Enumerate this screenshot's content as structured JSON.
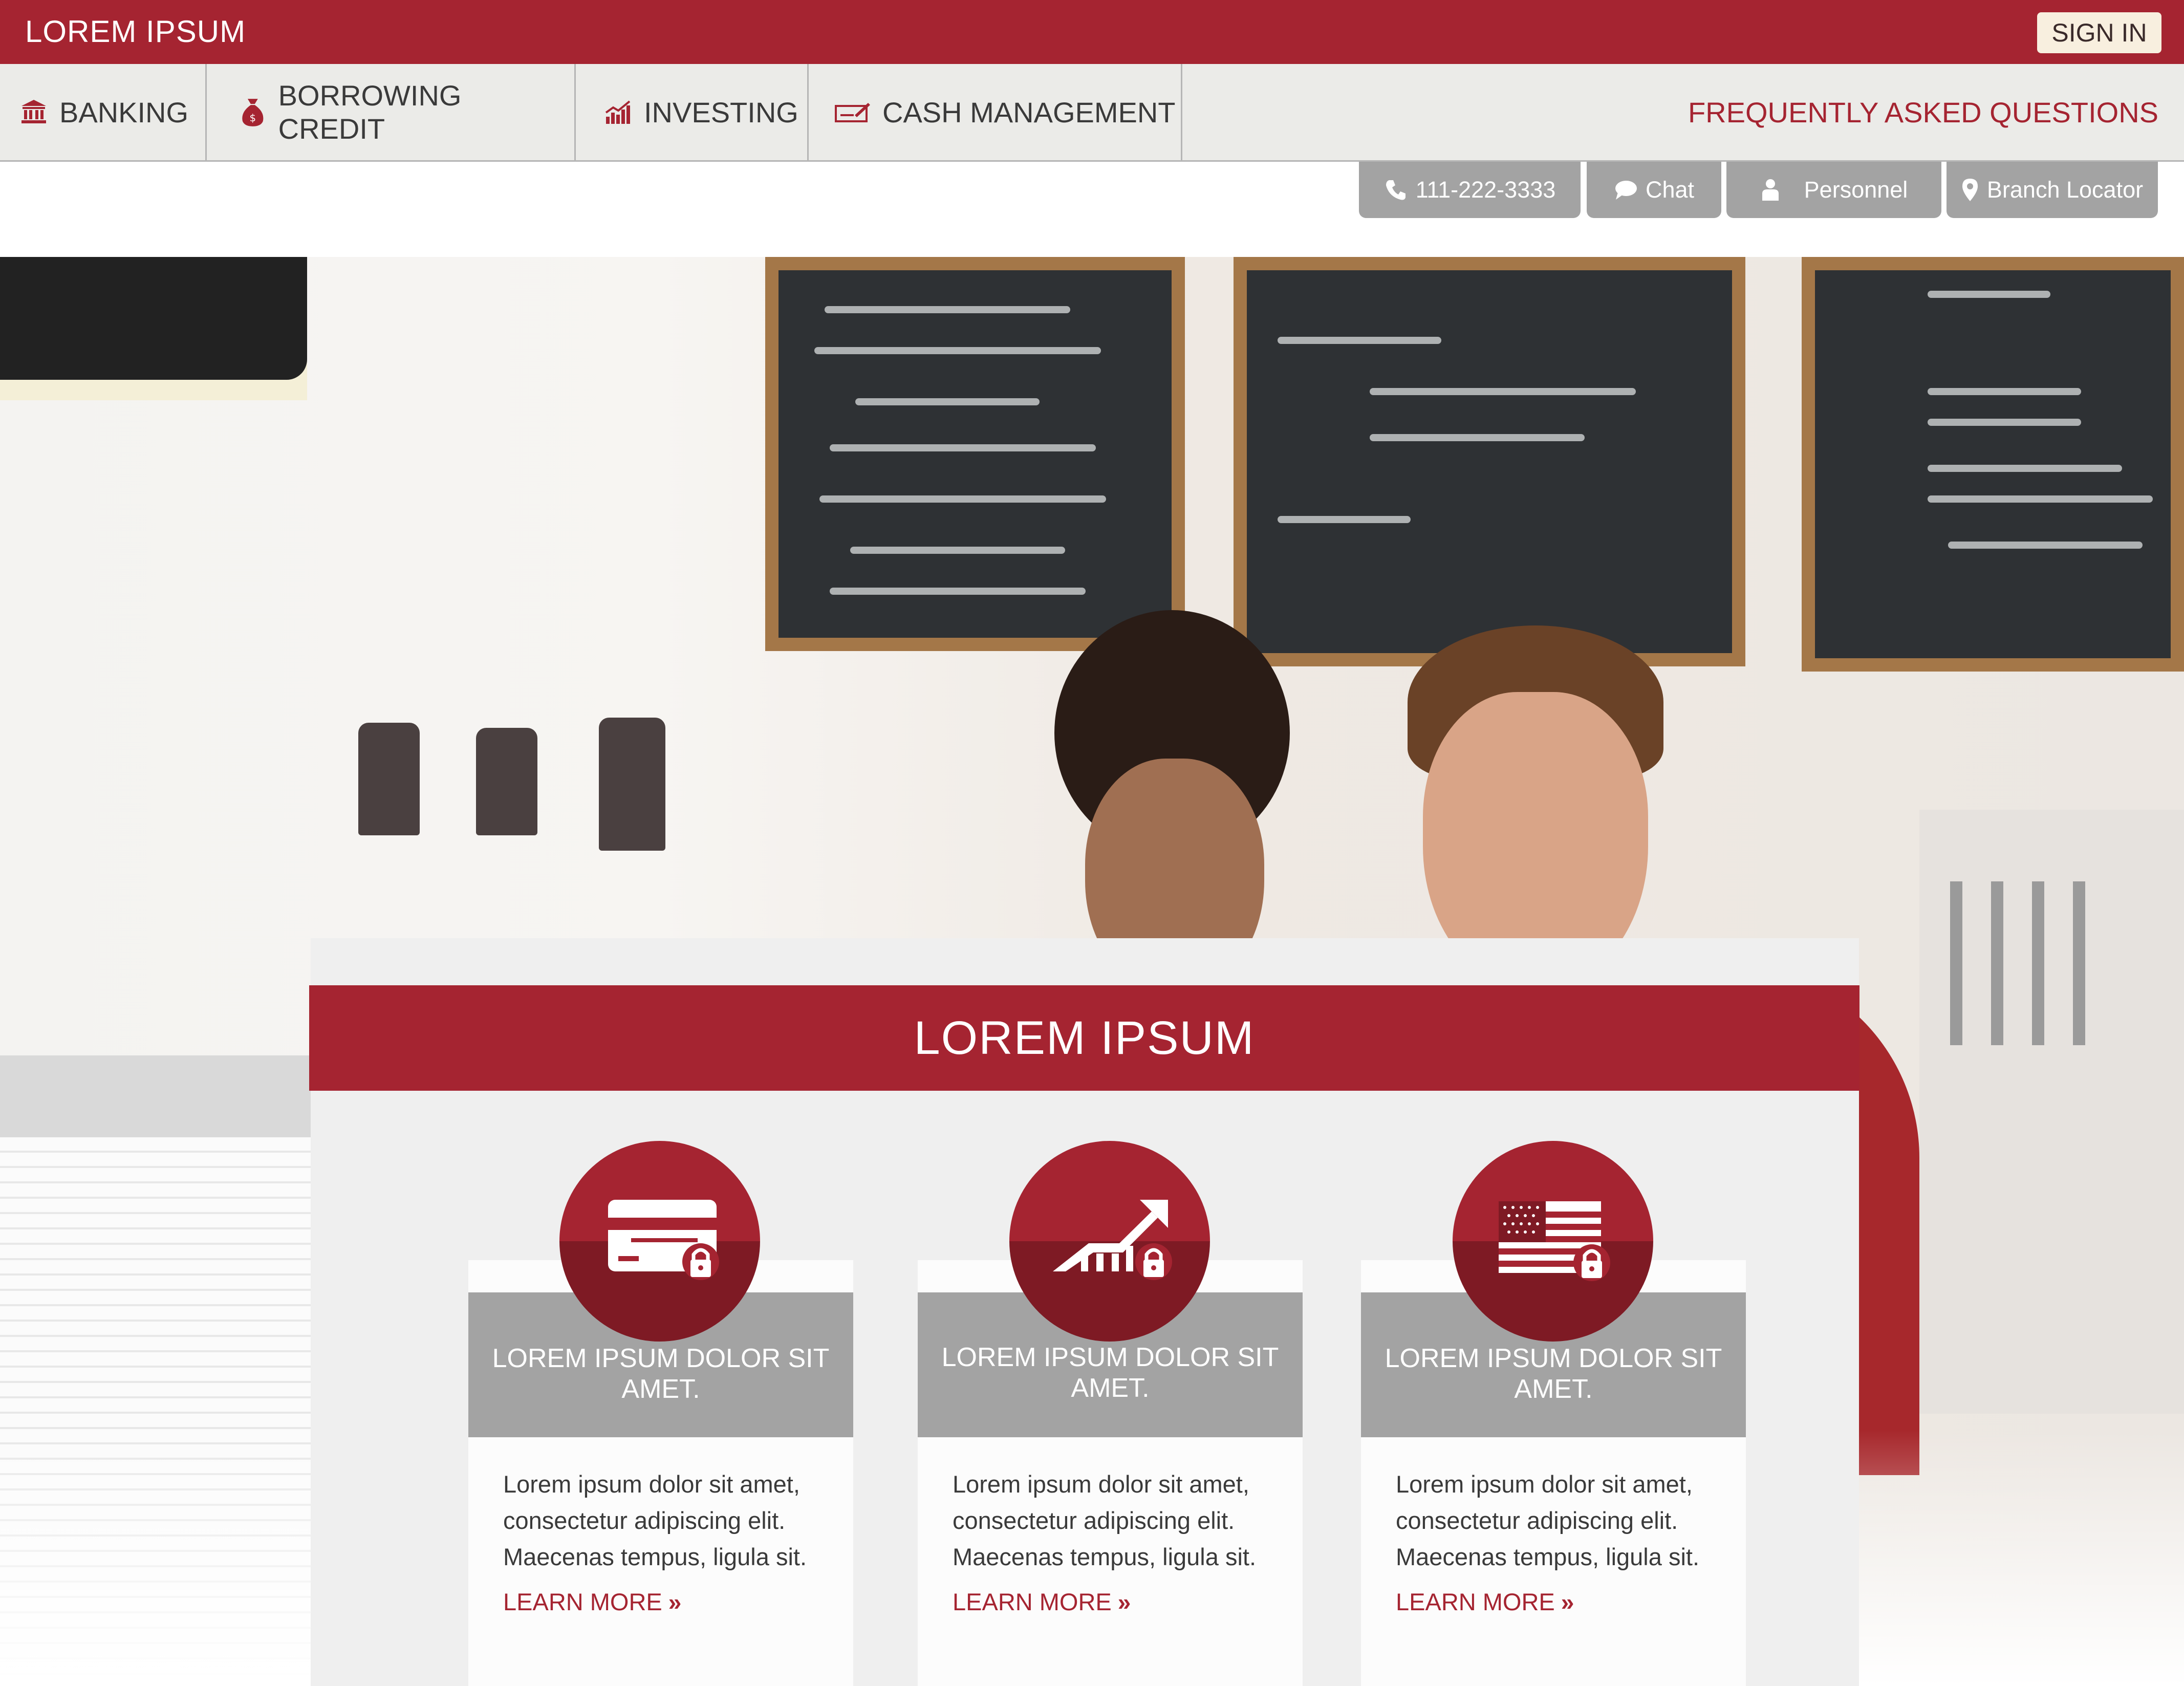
{
  "header": {
    "brand": "LOREM IPSUM",
    "sign_in": "SIGN IN"
  },
  "nav": {
    "items": [
      {
        "label": "BANKING",
        "icon": "bank-icon"
      },
      {
        "label": "BORROWING CREDIT",
        "icon": "money-bag-icon"
      },
      {
        "label": "INVESTING",
        "icon": "growth-chart-icon"
      },
      {
        "label": "CASH MANAGEMENT",
        "icon": "check-pen-icon"
      }
    ],
    "faq": "FREQUENTLY ASKED QUESTIONS"
  },
  "utility": {
    "phone": "111-222-3333",
    "chat": "Chat",
    "personnel": "Personnel",
    "branch": "Branch Locator"
  },
  "main": {
    "banner_title": "LOREM IPSUM",
    "cards": [
      {
        "icon": "credit-card-lock-icon",
        "title_line1": "LOREM IPSUM DOLOR SIT",
        "title_line2": "AMET.",
        "body_line1": "Lorem ipsum dolor sit amet,",
        "body_line2": "consectetur adipiscing elit.",
        "body_line3": "Maecenas tempus, ligula sit.",
        "link": "LEARN MORE"
      },
      {
        "icon": "growth-arrow-lock-icon",
        "title_line1": "LOREM IPSUM DOLOR SIT",
        "title_line2": "AMET.",
        "body_line1": "Lorem ipsum dolor sit amet,",
        "body_line2": "consectetur adipiscing elit.",
        "body_line3": "Maecenas tempus, ligula sit.",
        "link": "LEARN MORE"
      },
      {
        "icon": "us-flag-lock-icon",
        "title_line1": "LOREM IPSUM DOLOR SIT",
        "title_line2": "AMET.",
        "body_line1": "Lorem ipsum dolor sit amet,",
        "body_line2": "consectetur adipiscing elit.",
        "body_line3": "Maecenas tempus, ligula sit.",
        "link": "LEARN MORE"
      }
    ]
  },
  "colors": {
    "brand_red": "#a52431",
    "dark_red": "#7e1a24",
    "gray_tab": "#a3a3a3",
    "nav_bg": "#ebebe8",
    "sign_in_bg": "#f8efdf"
  }
}
